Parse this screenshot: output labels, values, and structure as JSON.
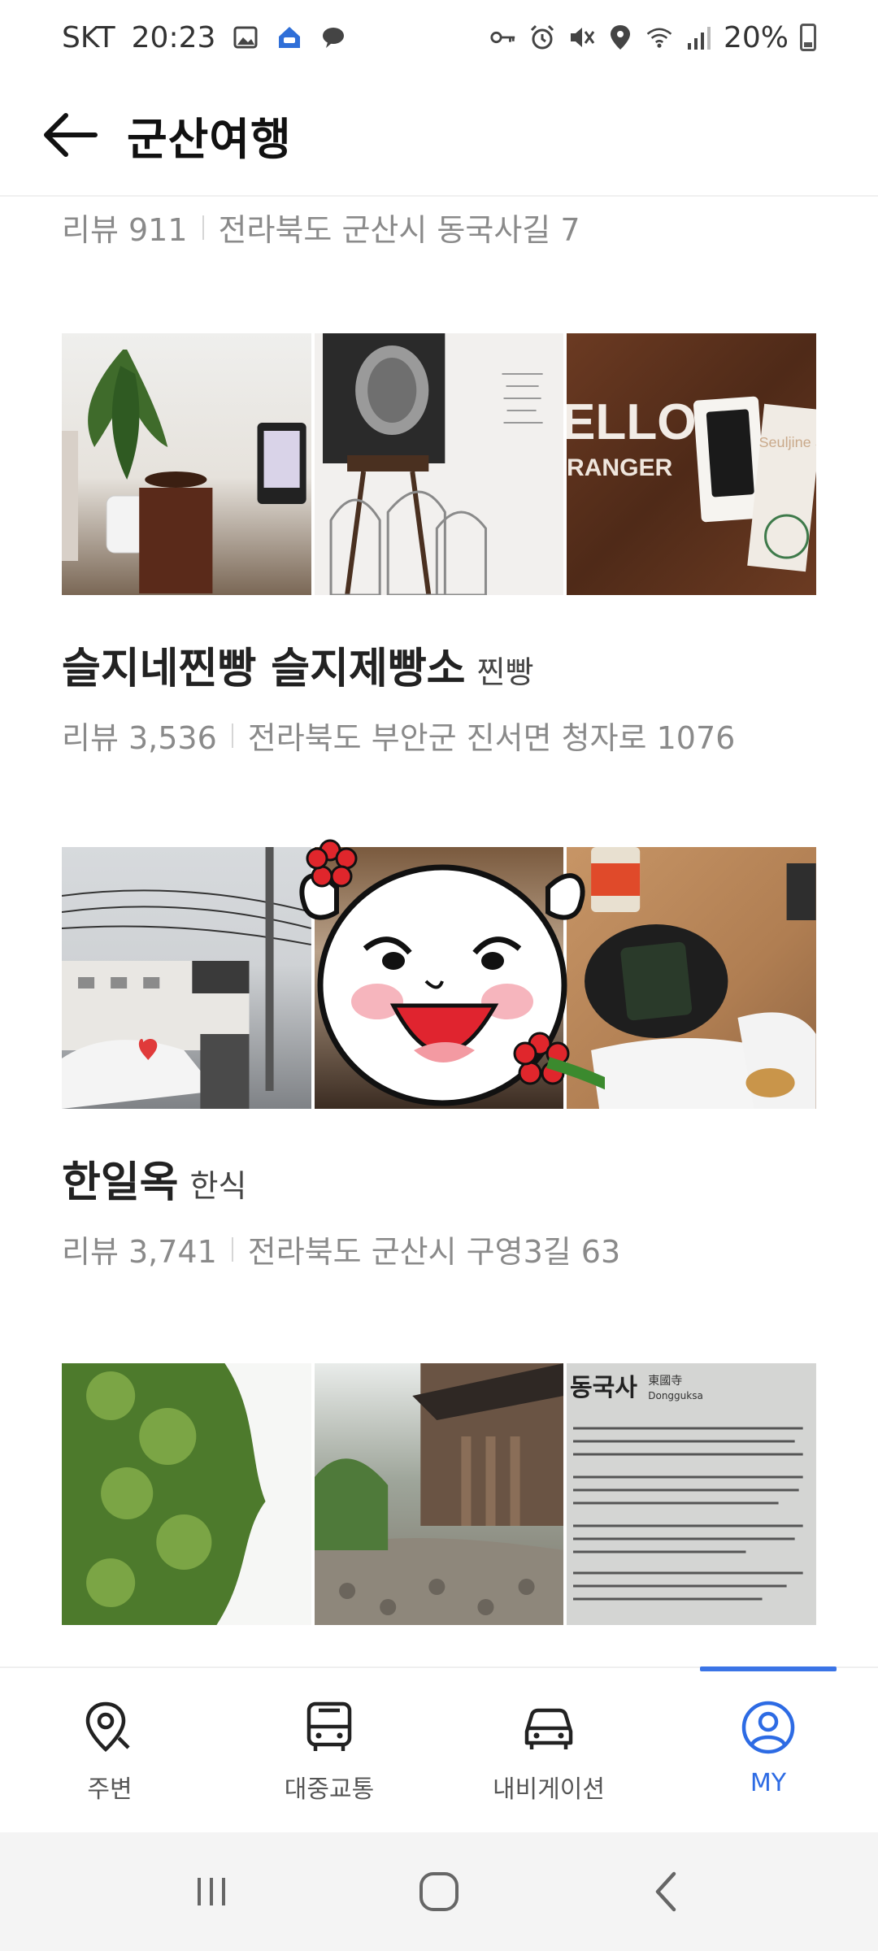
{
  "status_bar": {
    "carrier": "SKT",
    "time": "20:23",
    "battery": "20%"
  },
  "header": {
    "title": "군산여행"
  },
  "partial_row": {
    "reviews": "리뷰 911",
    "address": "전라북도 군산시 동국사길 7"
  },
  "places": [
    {
      "name": "슬지네찐빵 슬지제빵소",
      "category": "찐빵",
      "reviews": "리뷰 3,536",
      "address": "전라북도 부안군 진서면 청자로 1076",
      "photo_texts": [
        "ELLO",
        "RANGER",
        "Seuljine Story"
      ]
    },
    {
      "name": "한일옥",
      "category": "한식",
      "reviews": "리뷰 3,741",
      "address": "전라북도 군산시 구영3길 63"
    },
    {
      "photo_texts": [
        "동국사",
        "東國寺",
        "Dongguksa"
      ]
    }
  ],
  "bottom_nav": [
    {
      "label": "주변",
      "icon": "location-pin-icon"
    },
    {
      "label": "대중교통",
      "icon": "bus-icon"
    },
    {
      "label": "내비게이션",
      "icon": "car-icon"
    },
    {
      "label": "MY",
      "icon": "profile-icon",
      "active": true
    }
  ],
  "colors": {
    "accent": "#3a74e6",
    "secondary_text": "#8a8a8a",
    "title_text": "#111111"
  }
}
